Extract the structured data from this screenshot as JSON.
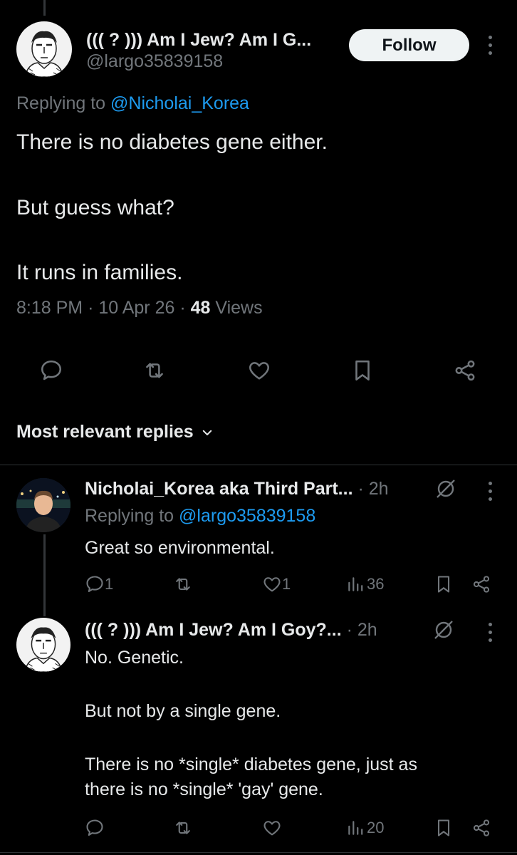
{
  "main_tweet": {
    "author_name": "((( ? ))) Am I Jew? Am I G...",
    "handle": "@largo35839158",
    "follow_label": "Follow",
    "replying_prefix": "Replying to",
    "replying_handle": "@Nicholai_Korea",
    "text_lines": [
      "There is no diabetes gene either.",
      "But guess what?",
      "It runs in families."
    ],
    "time": "8:18 PM",
    "sep1": "·",
    "date": "10 Apr 26",
    "sep2": "·",
    "views_count": "48",
    "views_label": "Views"
  },
  "replies_sort": {
    "label": "Most relevant replies"
  },
  "reply1": {
    "author_name": "Nicholai_Korea aka Third Part...",
    "sep": "·",
    "time": "2h",
    "replying_prefix": "Replying to",
    "replying_handle": "@largo35839158",
    "text": "Great so environmental.",
    "reply_count": "1",
    "like_count": "1",
    "view_count": "36"
  },
  "reply2": {
    "author_name": "((( ? ))) Am I Jew? Am I Goy?...",
    "sep": "·",
    "time": "2h",
    "text_lines": [
      "No. Genetic.",
      "But not by a single gene.",
      "There is no *single* diabetes gene, just as",
      "there is no *single* 'gay' gene."
    ],
    "view_count": "20"
  },
  "colors": {
    "background": "#000000",
    "text": "#e7e9ea",
    "muted": "#71767b",
    "link": "#1d9bf0",
    "divider": "#2f3336"
  },
  "icons": [
    "reply-icon",
    "retweet-icon",
    "like-icon",
    "bookmark-icon",
    "share-icon",
    "more-icon",
    "grok-icon",
    "views-icon",
    "chevron-down-icon"
  ]
}
